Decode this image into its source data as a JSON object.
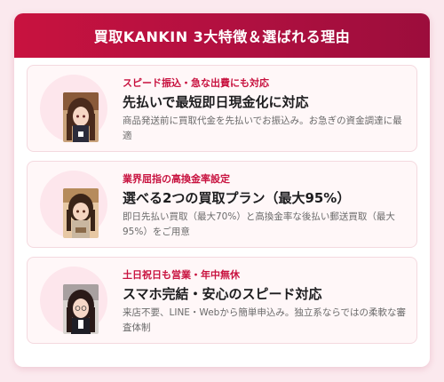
{
  "header": {
    "title": "買取KANKIN 3大特徴＆選ばれる理由"
  },
  "features": [
    {
      "tag": "スピード振込・急な出費にも対応",
      "title": "先払いで最短即日現金化に対応",
      "desc": "商品発送前に買取代金を先払いでお振込み。お急ぎの資金調達に最適"
    },
    {
      "tag": "業界屈指の高換金率設定",
      "title": "選べる2つの買取プラン（最大95%）",
      "desc": "即日先払い買取（最大70%）と高換金率な後払い郵送買取（最大95%）をご用意"
    },
    {
      "tag": "土日祝日も営業・年中無休",
      "title": "スマホ完結・安心のスピード対応",
      "desc": "来店不要、LINE・Webから簡単申込み。独立系ならではの柔軟な審査体制"
    }
  ],
  "colors": {
    "accent": "#c8123f",
    "header_dark": "#9c0d3c",
    "card_bg": "#fff7f8",
    "page_bg": "#fbe9ee"
  }
}
